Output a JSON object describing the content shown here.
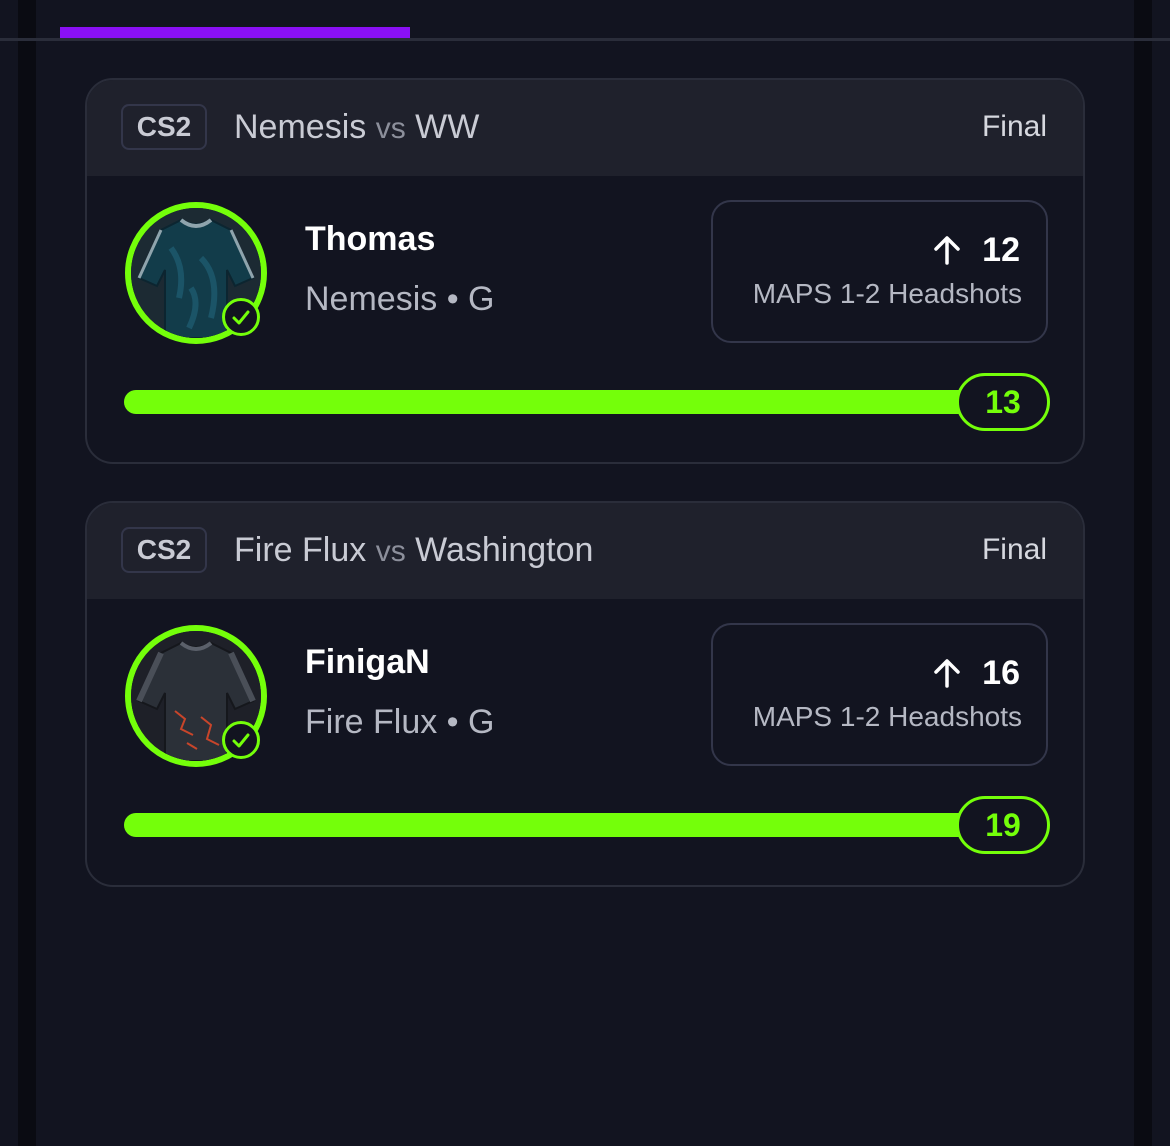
{
  "colors": {
    "accent_green": "#74ff0a",
    "accent_purple": "#8a10f5",
    "background": "#121420",
    "header_bg": "#1f212c"
  },
  "cards": [
    {
      "game": "CS2",
      "team_a": "Nemesis",
      "vs": "vs",
      "team_b": "WW",
      "status": "Final",
      "player_name": "Thomas",
      "player_team": "Nemesis • G",
      "direction_icon": "arrow-up-icon",
      "line_value": "12",
      "stat_label": "MAPS 1-2 Headshots",
      "result": "13",
      "progress_fraction": 1.0
    },
    {
      "game": "CS2",
      "team_a": "Fire Flux",
      "vs": "vs",
      "team_b": "Washington",
      "status": "Final",
      "player_name": "FinigaN",
      "player_team": "Fire Flux • G",
      "direction_icon": "arrow-up-icon",
      "line_value": "16",
      "stat_label": "MAPS 1-2 Headshots",
      "result": "19",
      "progress_fraction": 1.0
    }
  ]
}
